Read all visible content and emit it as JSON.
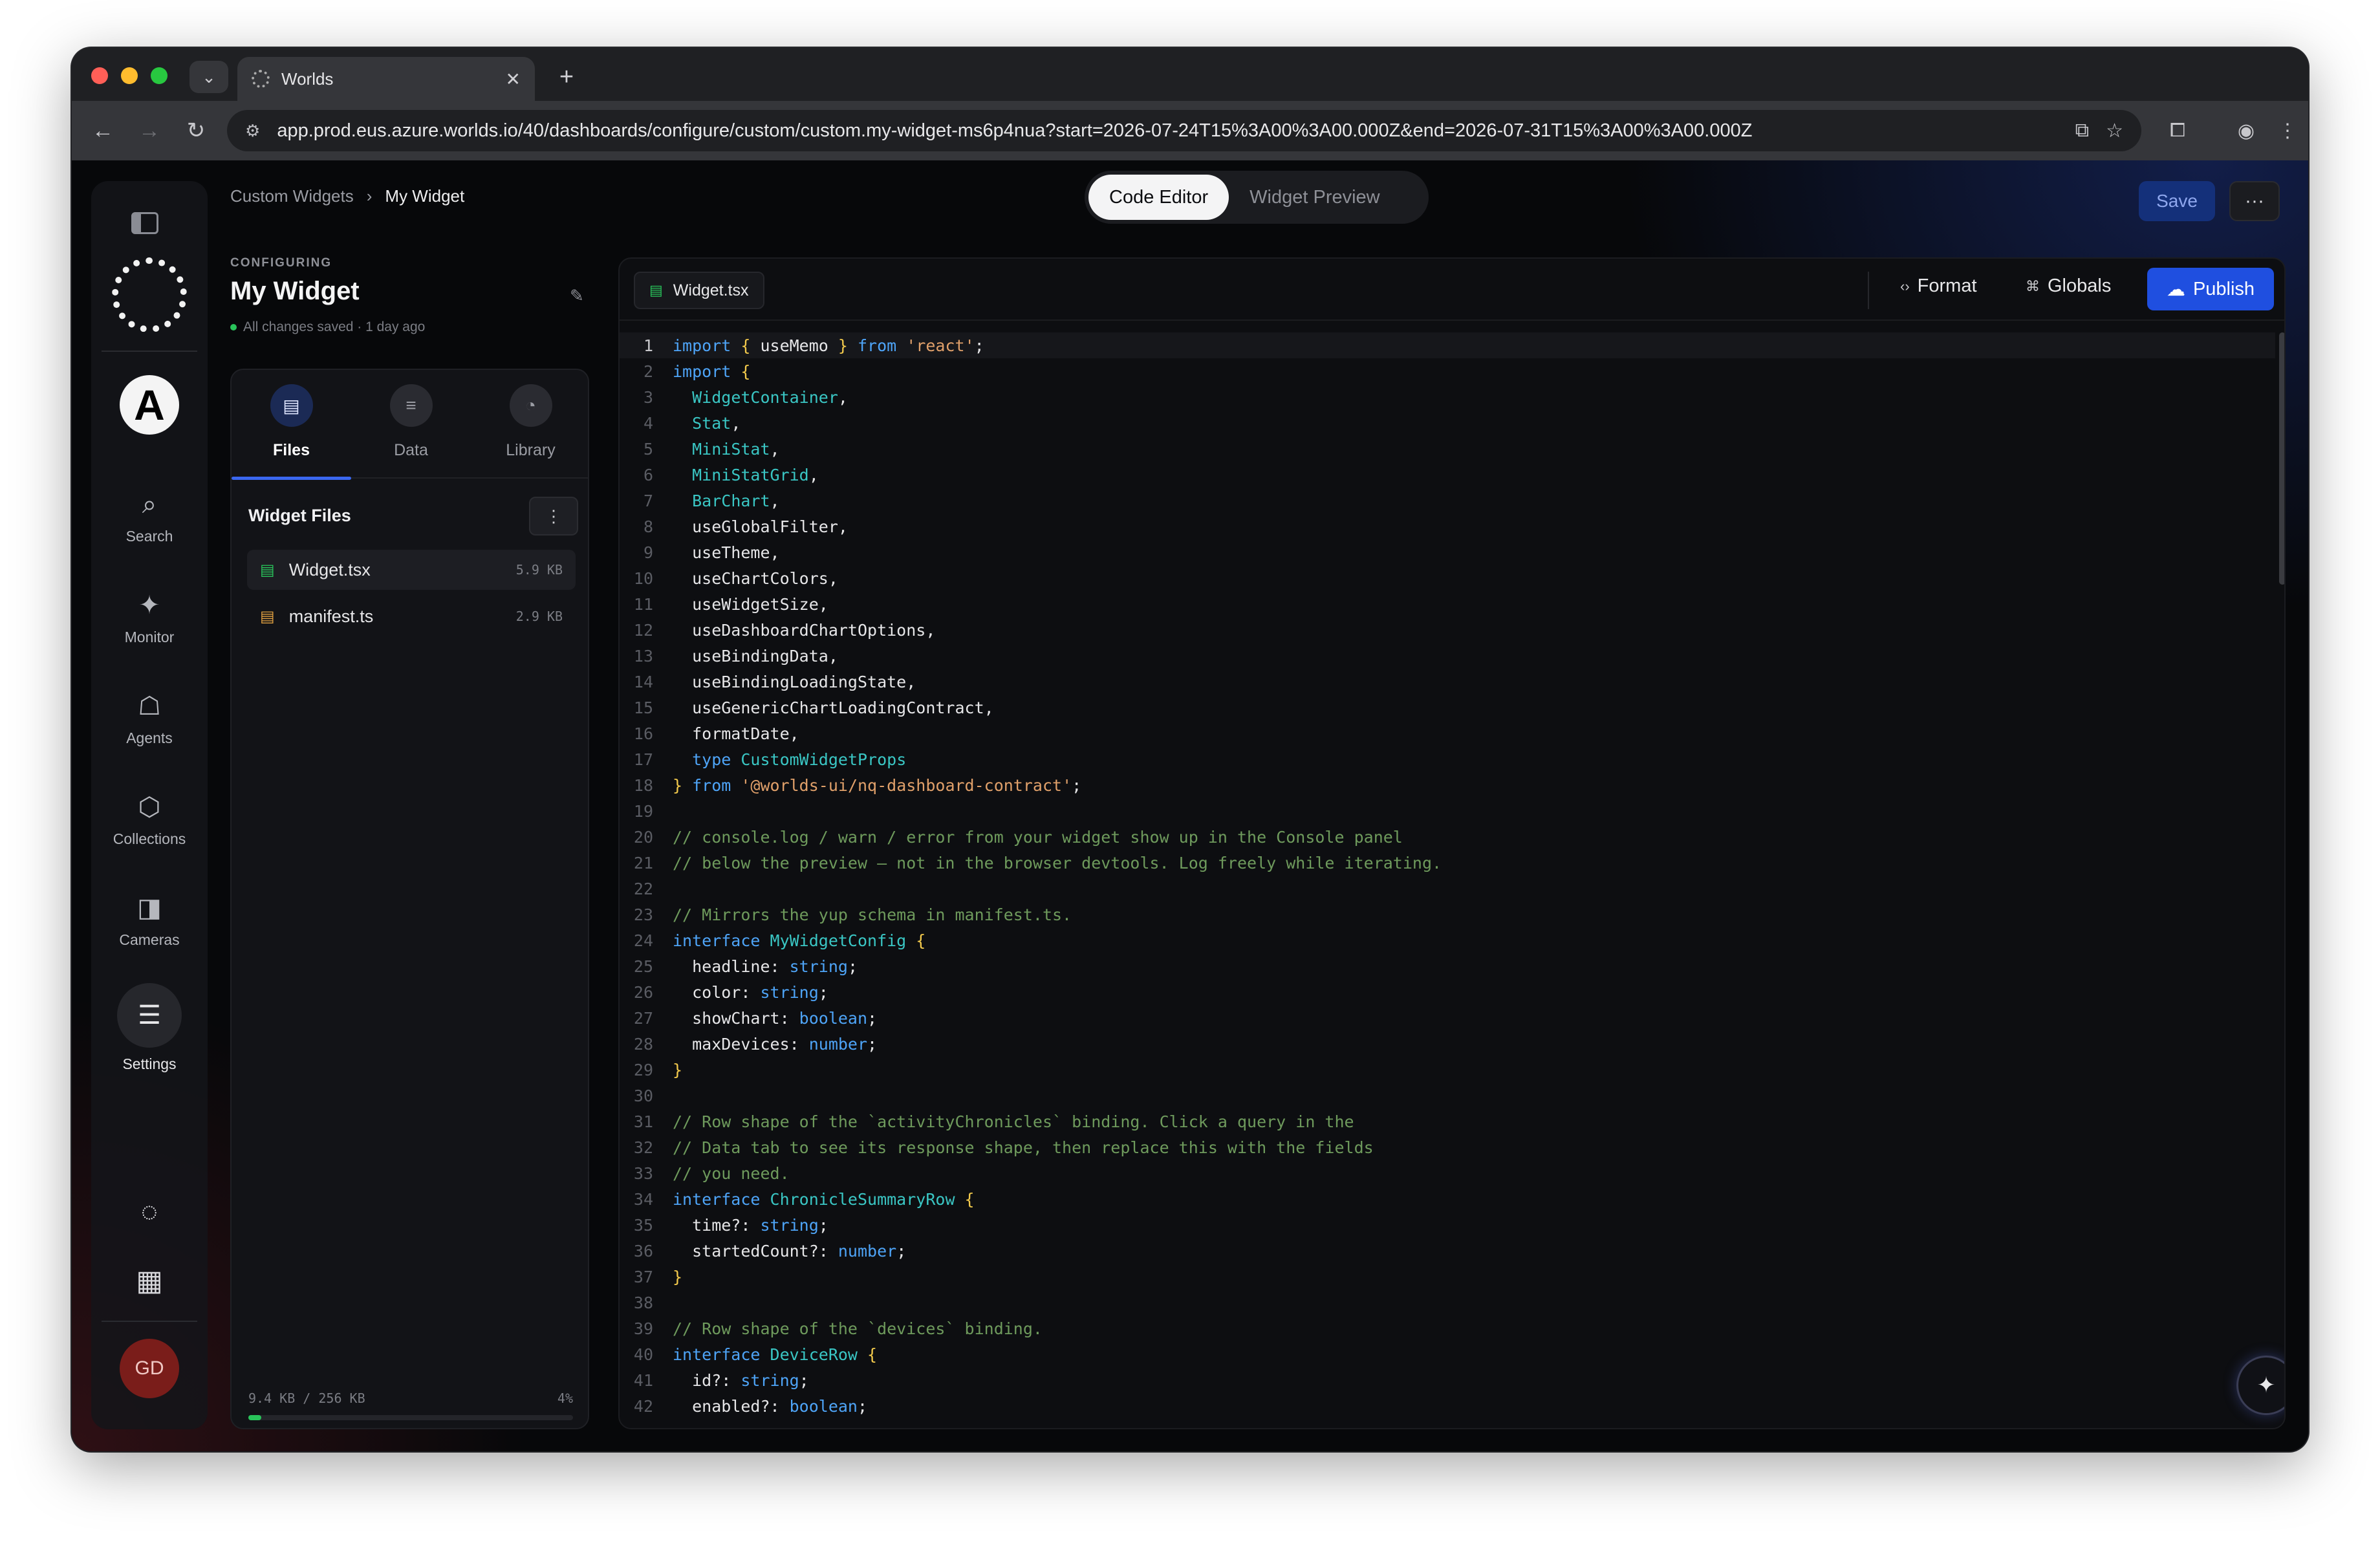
{
  "browser": {
    "tab_title": "Worlds",
    "url": "app.prod.eus.azure.worlds.io/40/dashboards/configure/custom/custom.my-widget-ms6p4nua?start=2026-07-24T15%3A00%3A00.000Z&end=2026-07-31T15%3A00%3A00.000Z"
  },
  "sidebar": {
    "avatar_letter": "A",
    "items": [
      {
        "label": "Search",
        "icon": "search-icon"
      },
      {
        "label": "Monitor",
        "icon": "monitor-icon"
      },
      {
        "label": "Agents",
        "icon": "robot-icon"
      },
      {
        "label": "Collections",
        "icon": "box-icon"
      },
      {
        "label": "Cameras",
        "icon": "camera-icon"
      },
      {
        "label": "Settings",
        "icon": "sliders-icon"
      }
    ],
    "user_initials": "GD"
  },
  "header": {
    "breadcrumb": [
      "Custom Widgets",
      "My Widget"
    ],
    "view_tabs": [
      "Code Editor",
      "Widget Preview"
    ],
    "active_view": "Code Editor",
    "save_label": "Save",
    "more_label": "···"
  },
  "config": {
    "label": "CONFIGURING",
    "title": "My Widget",
    "status": "All changes saved · 1 day ago",
    "status_color": "#29c35a"
  },
  "panel": {
    "tabs": [
      "Files",
      "Data",
      "Library"
    ],
    "active_tab": "Files",
    "files_heading": "Widget Files",
    "files": [
      {
        "name": "Widget.tsx",
        "size": "5.9 KB",
        "color": "#29c35a"
      },
      {
        "name": "manifest.ts",
        "size": "2.9 KB",
        "color": "#e0a040"
      }
    ],
    "quota_used": "9.4 KB / 256 KB",
    "quota_percent": "4%",
    "quota_fraction": 0.04
  },
  "editor": {
    "file_tab": "Widget.tsx",
    "format_label": "Format",
    "globals_label": "Globals",
    "publish_label": "Publish",
    "current_line": 1,
    "lines": [
      [
        [
          "k",
          "import "
        ],
        [
          "b",
          "{ "
        ],
        [
          "p",
          "useMemo "
        ],
        [
          "b",
          "} "
        ],
        [
          "k",
          "from "
        ],
        [
          "s",
          "'react'"
        ],
        [
          "p",
          ";"
        ]
      ],
      [
        [
          "k",
          "import "
        ],
        [
          "b",
          "{"
        ]
      ],
      [
        [
          "p",
          "  "
        ],
        [
          "t",
          "WidgetContainer"
        ],
        [
          "p",
          ","
        ]
      ],
      [
        [
          "p",
          "  "
        ],
        [
          "t",
          "Stat"
        ],
        [
          "p",
          ","
        ]
      ],
      [
        [
          "p",
          "  "
        ],
        [
          "t",
          "MiniStat"
        ],
        [
          "p",
          ","
        ]
      ],
      [
        [
          "p",
          "  "
        ],
        [
          "t",
          "MiniStatGrid"
        ],
        [
          "p",
          ","
        ]
      ],
      [
        [
          "p",
          "  "
        ],
        [
          "t",
          "BarChart"
        ],
        [
          "p",
          ","
        ]
      ],
      [
        [
          "p",
          "  useGlobalFilter,"
        ]
      ],
      [
        [
          "p",
          "  useTheme,"
        ]
      ],
      [
        [
          "p",
          "  useChartColors,"
        ]
      ],
      [
        [
          "p",
          "  useWidgetSize,"
        ]
      ],
      [
        [
          "p",
          "  useDashboardChartOptions,"
        ]
      ],
      [
        [
          "p",
          "  useBindingData,"
        ]
      ],
      [
        [
          "p",
          "  useBindingLoadingState,"
        ]
      ],
      [
        [
          "p",
          "  useGenericChartLoadingContract,"
        ]
      ],
      [
        [
          "p",
          "  formatDate,"
        ]
      ],
      [
        [
          "p",
          "  "
        ],
        [
          "k",
          "type "
        ],
        [
          "t",
          "CustomWidgetProps"
        ]
      ],
      [
        [
          "b",
          "} "
        ],
        [
          "k",
          "from "
        ],
        [
          "s",
          "'@worlds-ui/nq-dashboard-contract'"
        ],
        [
          "p",
          ";"
        ]
      ],
      [],
      [
        [
          "c",
          "// console.log / warn / error from your widget show up in the Console panel"
        ]
      ],
      [
        [
          "c",
          "// below the preview — not in the browser devtools. Log freely while iterating."
        ]
      ],
      [],
      [
        [
          "c",
          "// Mirrors the yup schema in manifest.ts."
        ]
      ],
      [
        [
          "k",
          "interface "
        ],
        [
          "t",
          "MyWidgetConfig "
        ],
        [
          "b",
          "{"
        ]
      ],
      [
        [
          "p",
          "  headline: "
        ],
        [
          "k",
          "string"
        ],
        [
          "p",
          ";"
        ]
      ],
      [
        [
          "p",
          "  color: "
        ],
        [
          "k",
          "string"
        ],
        [
          "p",
          ";"
        ]
      ],
      [
        [
          "p",
          "  showChart: "
        ],
        [
          "k",
          "boolean"
        ],
        [
          "p",
          ";"
        ]
      ],
      [
        [
          "p",
          "  maxDevices: "
        ],
        [
          "k",
          "number"
        ],
        [
          "p",
          ";"
        ]
      ],
      [
        [
          "b",
          "}"
        ]
      ],
      [],
      [
        [
          "c",
          "// Row shape of the `activityChronicles` binding. Click a query in the"
        ]
      ],
      [
        [
          "c",
          "// Data tab to see its response shape, then replace this with the fields"
        ]
      ],
      [
        [
          "c",
          "// you need."
        ]
      ],
      [
        [
          "k",
          "interface "
        ],
        [
          "t",
          "ChronicleSummaryRow "
        ],
        [
          "b",
          "{"
        ]
      ],
      [
        [
          "p",
          "  time?: "
        ],
        [
          "k",
          "string"
        ],
        [
          "p",
          ";"
        ]
      ],
      [
        [
          "p",
          "  startedCount?: "
        ],
        [
          "k",
          "number"
        ],
        [
          "p",
          ";"
        ]
      ],
      [
        [
          "b",
          "}"
        ]
      ],
      [],
      [
        [
          "c",
          "// Row shape of the `devices` binding."
        ]
      ],
      [
        [
          "k",
          "interface "
        ],
        [
          "t",
          "DeviceRow "
        ],
        [
          "b",
          "{"
        ]
      ],
      [
        [
          "p",
          "  id?: "
        ],
        [
          "k",
          "string"
        ],
        [
          "p",
          ";"
        ]
      ],
      [
        [
          "p",
          "  enabled?: "
        ],
        [
          "k",
          "boolean"
        ],
        [
          "p",
          ";"
        ]
      ]
    ]
  }
}
